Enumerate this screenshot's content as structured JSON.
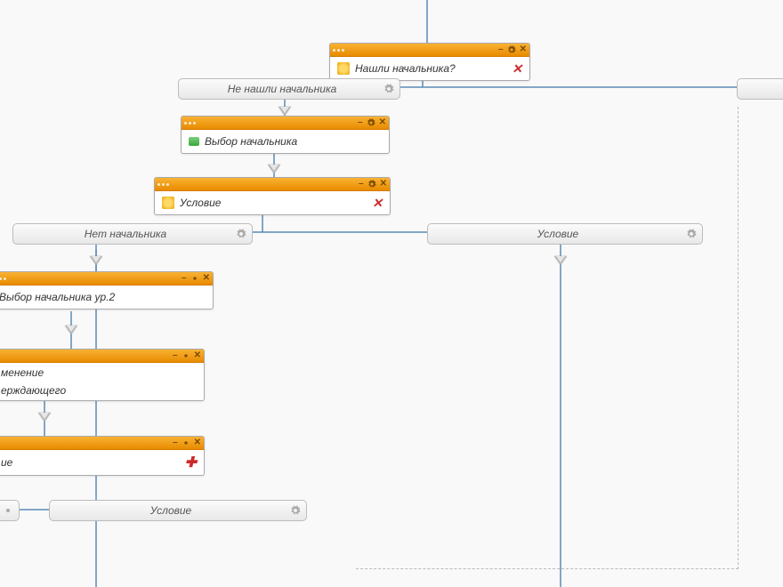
{
  "colors": {
    "accent": "#e88b00",
    "line": "#5a8bb5"
  },
  "nodes": {
    "n1": {
      "title": "Нашли начальника?",
      "icon": "branch-icon"
    },
    "n2": {
      "title": "Выбор начальника",
      "icon": "table-icon"
    },
    "n3": {
      "title": "Условие",
      "icon": "branch-icon"
    },
    "n4": {
      "title": "Выбор начальника ур.2",
      "icon": ""
    },
    "n5": {
      "title_line1": "менение",
      "title_line2": "ерждающего"
    },
    "n6": {
      "title": "ие"
    }
  },
  "branches": {
    "b1": {
      "label": "Не нашли начальника"
    },
    "b2": {
      "label": "Нет начальника"
    },
    "b3": {
      "label": "Условие"
    },
    "b4": {
      "label": "Условие"
    },
    "b5": {
      "label": ""
    }
  }
}
